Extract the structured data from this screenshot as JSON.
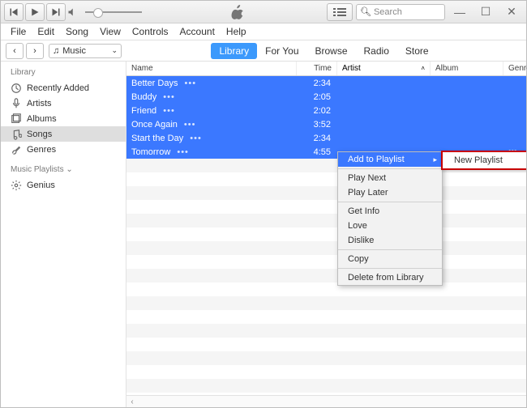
{
  "titlebar": {
    "search_placeholder": "Search"
  },
  "menubar": [
    "File",
    "Edit",
    "Song",
    "View",
    "Controls",
    "Account",
    "Help"
  ],
  "source_label": "Music",
  "tabs": [
    "Library",
    "For You",
    "Browse",
    "Radio",
    "Store"
  ],
  "sidebar": {
    "section1": "Library",
    "items1": [
      "Recently Added",
      "Artists",
      "Albums",
      "Songs",
      "Genres"
    ],
    "section2": "Music Playlists",
    "items2": [
      "Genius"
    ]
  },
  "columns": [
    "Name",
    "Time",
    "Artist",
    "Album",
    "Genre"
  ],
  "songs": [
    {
      "name": "Better Days",
      "time": "2:34"
    },
    {
      "name": "Buddy",
      "time": "2:05"
    },
    {
      "name": "Friend",
      "time": "2:02"
    },
    {
      "name": "Once Again",
      "time": "3:52"
    },
    {
      "name": "Start the Day",
      "time": "2:34"
    },
    {
      "name": "Tomorrow",
      "time": "4:55"
    }
  ],
  "context_menu": {
    "add_to_playlist": "Add to Playlist",
    "play_next": "Play Next",
    "play_later": "Play Later",
    "get_info": "Get Info",
    "love": "Love",
    "dislike": "Dislike",
    "copy": "Copy",
    "delete": "Delete from Library"
  },
  "submenu": {
    "new_playlist": "New Playlist"
  }
}
